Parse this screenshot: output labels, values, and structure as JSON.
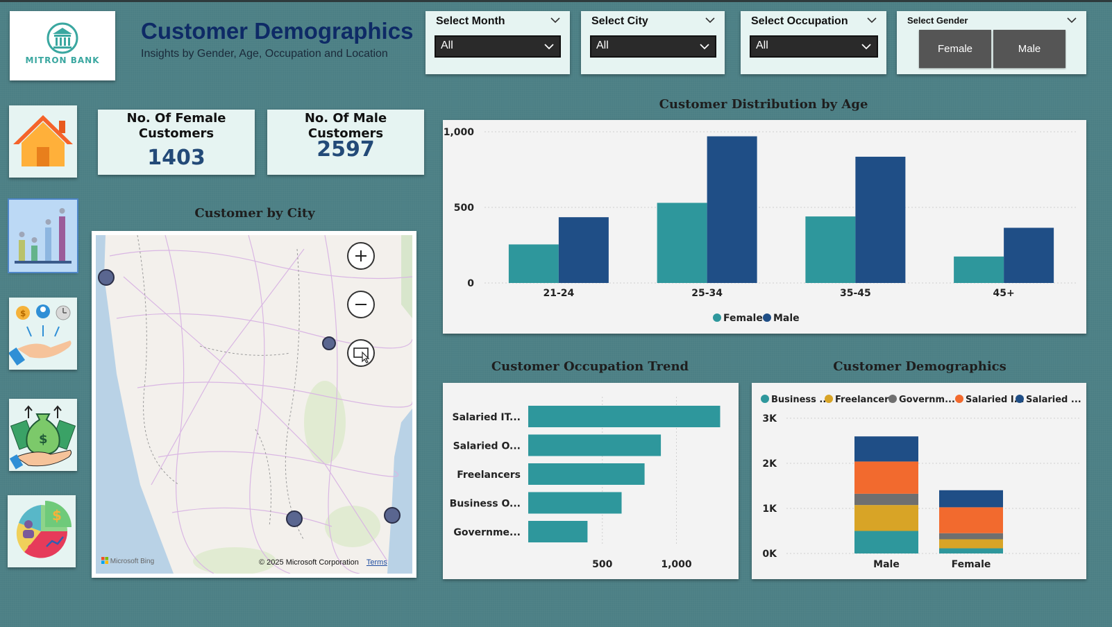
{
  "brand": {
    "logo_text": "MITRON BANK"
  },
  "header": {
    "title": "Customer Demographics",
    "subtitle": "Insights by Gender, Age, Occupation and Location"
  },
  "slicers": {
    "month": {
      "label": "Select Month",
      "value": "All"
    },
    "city": {
      "label": "Select City",
      "value": "All"
    },
    "occupation": {
      "label": "Select Occupation",
      "value": "All"
    },
    "gender": {
      "label": "Select Gender",
      "options": [
        "Female",
        "Male"
      ]
    }
  },
  "nav": {
    "items": [
      {
        "name": "home-icon"
      },
      {
        "name": "bar-chart-icon"
      },
      {
        "name": "income-hand-icon"
      },
      {
        "name": "money-bag-icon"
      },
      {
        "name": "pie-chart-icon"
      }
    ]
  },
  "kpis": {
    "female": {
      "label_line1": "No. Of Female",
      "label_line2": "Customers",
      "value": "1403"
    },
    "male": {
      "label": "No. Of Male Customers",
      "value": "2597"
    }
  },
  "map": {
    "title": "Customer by City",
    "copyright": "© 2025 Microsoft Corporation",
    "terms": "Terms",
    "bing": "Microsoft Bing"
  },
  "colors": {
    "female": "#2e979c",
    "male": "#1f4e86"
  },
  "chart_data": [
    {
      "type": "bar",
      "title": "Customer Distribution by Age",
      "categories": [
        "21-24",
        "25-34",
        "35-45",
        "45+"
      ],
      "series": [
        {
          "name": "Female",
          "values": [
            255,
            530,
            440,
            175
          ]
        },
        {
          "name": "Male",
          "values": [
            435,
            970,
            835,
            365
          ]
        }
      ],
      "yticks": [
        "0",
        "500",
        "1,000"
      ],
      "ylim": [
        0,
        1000
      ],
      "legend": "bottom"
    },
    {
      "type": "bar",
      "orientation": "horizontal",
      "title": "Customer Occupation Trend",
      "categories": [
        "Salaried IT...",
        "Salaried O...",
        "Freelancers",
        "Business O...",
        "Governme..."
      ],
      "values": [
        1295,
        895,
        785,
        630,
        400
      ],
      "xticks": [
        "500",
        "1,000"
      ],
      "color": "#2e979c"
    },
    {
      "type": "bar",
      "stacked": true,
      "title": "Customer Demographics",
      "categories": [
        "Male",
        "Female"
      ],
      "series": [
        {
          "name": "Business ...",
          "color": "#2e979c",
          "values": [
            500,
            115
          ]
        },
        {
          "name": "Freelancers",
          "color": "#d8a426",
          "values": [
            575,
            200
          ]
        },
        {
          "name": "Governm...",
          "color": "#6f6f6f",
          "values": [
            250,
            135
          ]
        },
        {
          "name": "Salaried I...",
          "color": "#f26a2e",
          "values": [
            715,
            575
          ]
        },
        {
          "name": "Salaried ...",
          "color": "#1f4e86",
          "values": [
            557,
            378
          ]
        }
      ],
      "yticks": [
        "0K",
        "1K",
        "2K",
        "3K"
      ],
      "ylim": [
        0,
        3000
      ],
      "legend": "top"
    }
  ]
}
